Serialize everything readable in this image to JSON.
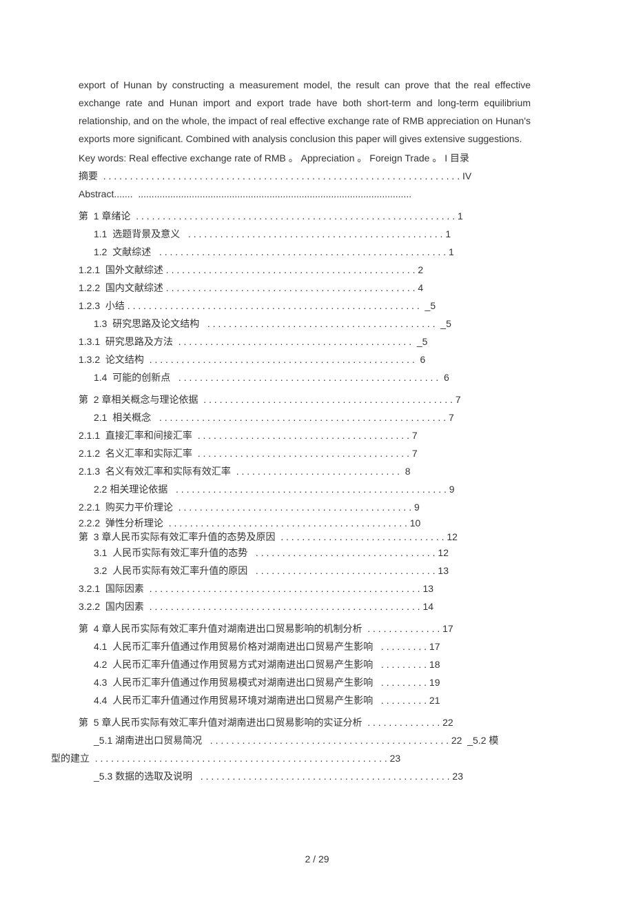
{
  "paragraph": "export of Hunan by constructing a measurement model, the result can prove that the real effective exchange rate and Hunan import and export trade have both short-term and long-term equilibrium relationship, and on the whole, the impact of real effective exchange rate of RMB appreciation on Hunan's exports more significant. Combined with analysis conclusion this paper will gives extensive suggestions.",
  "keywords_line": "Key words: Real effective exchange rate of RMB 。  Appreciation 。  Foreign Trade 。  I 目录",
  "toc": [
    {
      "text": "摘要  . . . . . . . . . . . . . . . . . . . . . . . . . . . . . . . . . . . . . . . . . . . . . . . . . . . . . . . . . . . . . . . . . . . IV",
      "indent": 0
    },
    {
      "text": "Abstract.......  ......................................................................................................",
      "indent": 0
    },
    {
      "text": "第  1 章绪论  . . . . . . . . . . . . . . . . . . . . . . . . . . . . . . . . . . . . . . . . . . . . . . . . . . . . . . . . . . . . 1",
      "indent": 0,
      "spaced": true
    },
    {
      "text": "1.1  选题背景及意义   . . . . . . . . . . . . . . . . . . . . . . . . . . . . . . . . . . . . . . . . . . . . . . . . 1",
      "indent": 1
    },
    {
      "text": "1.2  文献综述   . . . . . . . . . . . . . . . . . . . . . . . . . . . . . . . . . . . . . . . . . . . . . . . . . . . . . . 1",
      "indent": 1
    },
    {
      "text": "1.2.1  国外文献综述 . . . . . . . . . . . . . . . . . . . . . . . . . . . . . . . . . . . . . . . . . . . . . . . 2",
      "indent": 0
    },
    {
      "text": "1.2.2  国内文献综述 . . . . . . . . . . . . . . . . . . . . . . . . . . . . . . . . . . . . . . . . . . . . . . . 4",
      "indent": 0
    },
    {
      "text": "1.2.3  小结 . . . . . . . . . . . . . . . . . . . . . . . . . . . . . . . . . . . . . . . . . . . . . . . . . . . . . . .  _5",
      "indent": 0
    },
    {
      "text": "1.3  研究思路及论文结构   . . . . . . . . . . . . . . . . . . . . . . . . . . . . . . . . . . . . . . . . . . .  _5",
      "indent": 1
    },
    {
      "text": "1.3.1  研究思路及方法  . . . . . . . . . . . . . . . . . . . . . . . . . . . . . . . . . . . . . . . . . . . .  _5",
      "indent": 0
    },
    {
      "text": "1.3.2  论文结构  . . . . . . . . . . . . . . . . . . . . . . . . . . . . . . . . . . . . . . . . . . . . . . . . . .  6",
      "indent": 0
    },
    {
      "text": "1.4  可能的创新点   . . . . . . . . . . . . . . . . . . . . . . . . . . . . . . . . . . . . . . . . . . . . . . . . .  6",
      "indent": 1
    },
    {
      "text": "第  2 章相关概念与理论依据  . . . . . . . . . . . . . . . . . . . . . . . . . . . . . . . . . . . . . . . . . . . . . . . 7",
      "indent": 0,
      "spaced": true
    },
    {
      "text": "2.1  相关概念   . . . . . . . . . . . . . . . . . . . . . . . . . . . . . . . . . . . . . . . . . . . . . . . . . . . . . . 7",
      "indent": 1
    },
    {
      "text": "2.1.1  直接汇率和间接汇率  . . . . . . . . . . . . . . . . . . . . . . . . . . . . . . . . . . . . . . . . 7",
      "indent": 0
    },
    {
      "text": "2.1.2  名义汇率和实际汇率  . . . . . . . . . . . . . . . . . . . . . . . . . . . . . . . . . . . . . . . . 7",
      "indent": 0
    },
    {
      "text": "2.1.3  名义有效汇率和实际有效汇率  . . . . . . . . . . . . . . . . . . . . . . . . . . . . . . .  8",
      "indent": 0
    },
    {
      "text": "2.2 相关理论依据   . . . . . . . . . . . . . . . . . . . . . . . . . . . . . . . . . . . . . . . . . . . . . . . . . . . 9",
      "indent": 1
    },
    {
      "text": "2.2.1  购买力平价理论  . . . . . . . . . . . . . . . . . . . . . . . . . . . . . . . . . . . . . . . . . . . . 9",
      "indent": 0
    },
    {
      "text": "2.2.2  弹性分析理论  . . . . . . . . . . . . . . . . . . . . . . . . . . . . . . . . . . . . . . . . . . . . . 10",
      "indent": 0,
      "tight": true
    },
    {
      "text": "第  3 章人民币实际有效汇率升值的态势及原因  . . . . . . . . . . . . . . . . . . . . . . . . . . . . . . . 12",
      "indent": 0,
      "tight": true
    },
    {
      "text": "3.1  人民币实际有效汇率升值的态势   . . . . . . . . . . . . . . . . . . . . . . . . . . . . . . . . . . 12",
      "indent": 1
    },
    {
      "text": "3.2  人民币实际有效汇率升值的原因   . . . . . . . . . . . . . . . . . . . . . . . . . . . . . . . . . . 13",
      "indent": 1
    },
    {
      "text": "3.2.1  国际因素  . . . . . . . . . . . . . . . . . . . . . . . . . . . . . . . . . . . . . . . . . . . . . . . . . . . 13",
      "indent": 0
    },
    {
      "text": "3.2.2  国内因素  . . . . . . . . . . . . . . . . . . . . . . . . . . . . . . . . . . . . . . . . . . . . . . . . . . . 14",
      "indent": 0
    },
    {
      "text": "第  4 章人民币实际有效汇率升值对湖南进出口贸易影响的机制分析  . . . . . . . . . . . . . . 17",
      "indent": 0,
      "spaced": true
    },
    {
      "text": "4.1  人民币汇率升值通过作用贸易价格对湖南进出口贸易产生影响   . . . . . . . . . 17",
      "indent": 1
    },
    {
      "text": "4.2  人民币汇率升值通过作用贸易方式对湖南进出口贸易产生影响   . . . . . . . . . 18",
      "indent": 1
    },
    {
      "text": "4.3  人民币汇率升值通过作用贸易模式对湖南进出口贸易产生影响   . . . . . . . . . 19",
      "indent": 1
    },
    {
      "text": "4.4  人民币汇率升值通过作用贸易环境对湖南进出口贸易产生影响   . . . . . . . . . 21",
      "indent": 1
    },
    {
      "text": "第  5 章人民币实际有效汇率升值对湖南进出口贸易影响的实证分析  . . . . . . . . . . . . . . 22",
      "indent": 0,
      "spaced": true
    },
    {
      "text": "_5.1 湖南进出口贸易简况   . . . . . . . . . . . . . . . . . . . . . . . . . . . . . . . . . . . . . . . . . . . . . 22  _5.2 模",
      "indent": 1,
      "wrap": true
    },
    {
      "text": "型的建立  . . . . . . . . . . . . . . . . . . . . . . . . . . . . . . . . . . . . . . . . . . . . . . . . . . . . . . . 23",
      "indent": -1
    },
    {
      "text": "_5.3 数据的选取及说明   . . . . . . . . . . . . . . . . . . . . . . . . . . . . . . . . . . . . . . . . . . . . . . . 23",
      "indent": 1
    }
  ],
  "footer": "2 / 29"
}
